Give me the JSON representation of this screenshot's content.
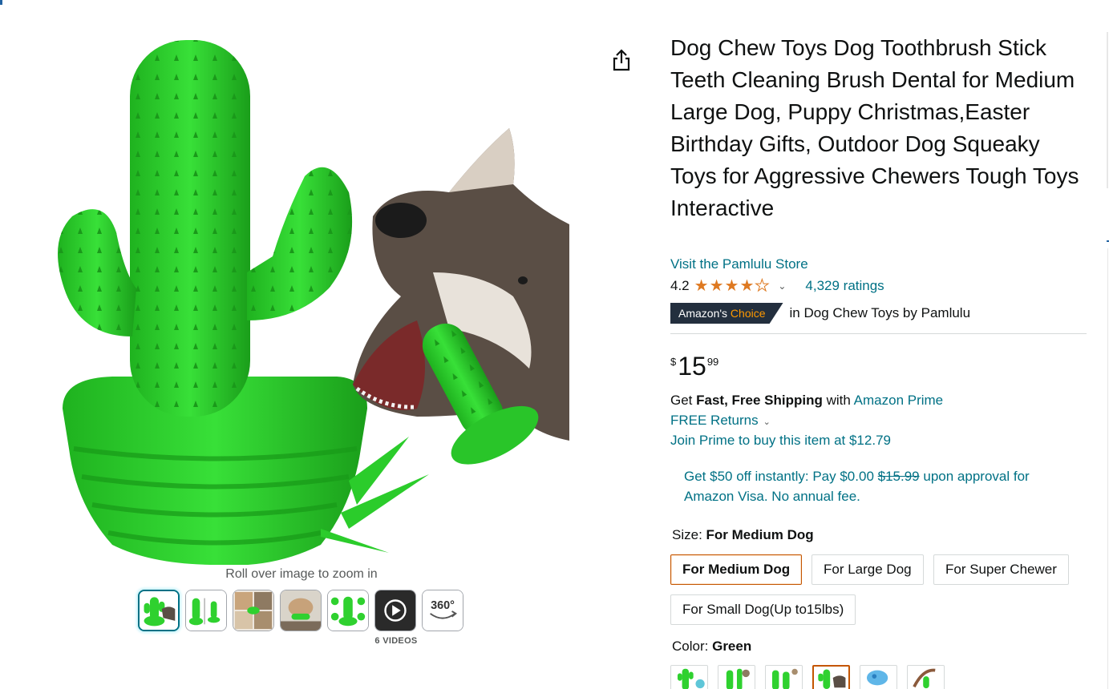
{
  "product": {
    "title": "Dog Chew Toys Dog Toothbrush Stick Teeth Cleaning Brush Dental for Medium Large Dog, Puppy Christmas,Easter Birthday Gifts, Outdoor Dog Squeaky Toys for Aggressive Chewers Tough Toys Interactive",
    "store_link": "Visit the Pamlulu Store",
    "rating_value": "4.2",
    "rating_stars": 4.2,
    "ratings_count": "4,329 ratings",
    "badge_prefix": "Amazon's",
    "badge_suffix": "Choice",
    "badge_context": "in Dog Chew Toys by Pamlulu"
  },
  "gallery": {
    "zoom_hint": "Roll over image to zoom in",
    "videos_label": "6 VIDEOS",
    "thumbs": [
      "cactus-dog-thumb",
      "cactus-dimensions-thumb",
      "dog-collage-thumb",
      "dog-chewing-thumb",
      "cactus-features-thumb",
      "video-play-thumb",
      "360-view-thumb"
    ],
    "view_360": "360°"
  },
  "price": {
    "symbol": "$",
    "whole": "15",
    "fraction": "99"
  },
  "delivery": {
    "get": "Get",
    "fast_free": "Fast, Free Shipping",
    "with": "with",
    "prime_link": "Amazon Prime",
    "returns": "FREE Returns",
    "join_prime": "Join Prime to buy this item at $12.79"
  },
  "visa_offer": {
    "pre": "Get $50 off instantly: Pay $0.00",
    "struck": "$15.99",
    "post": "upon approval for Amazon Visa. No annual fee."
  },
  "size": {
    "label": "Size:",
    "selected": "For Medium Dog",
    "options": [
      "For Medium Dog",
      "For Large Dog",
      "For Super Chewer",
      "For Small Dog(Up to15lbs)"
    ]
  },
  "color": {
    "label": "Color:",
    "selected": "Green"
  },
  "colors": {
    "accent_link": "#007185",
    "price_text": "#0f1111",
    "star": "#de7921",
    "badge_bg": "#232f3e",
    "badge_orange": "#ff9900",
    "selected_border": "#c45500",
    "product_green": "#2fd12f"
  }
}
